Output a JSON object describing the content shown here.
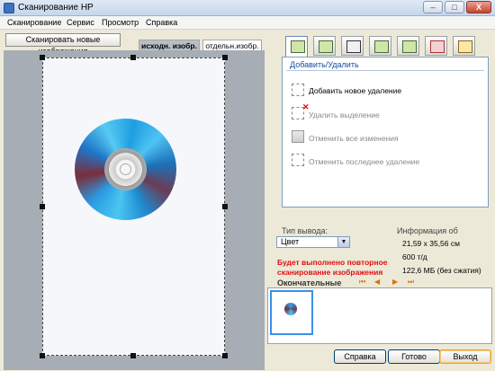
{
  "window": {
    "title": "Сканирование HP",
    "buttons": {
      "minimize": "–",
      "maximize": "□",
      "close": "X"
    }
  },
  "menu": [
    "Сканирование",
    "Сервис",
    "Просмотр",
    "Справка"
  ],
  "scan_new_button": "Сканировать новые изображения",
  "tabs": {
    "original": "исходн. изобр.",
    "separate": "отдельн.изобр."
  },
  "panel": {
    "heading": "Добавить/Удалить",
    "actions": [
      {
        "label": "Добавить новое удаление",
        "enabled": true
      },
      {
        "label": "Удалить выделение",
        "enabled": false
      },
      {
        "label": "Отменить все изменения",
        "enabled": false
      },
      {
        "label": "Отменить последнее удаление",
        "enabled": false
      }
    ]
  },
  "output": {
    "label": "Тип вывода:",
    "selected": "Цвет"
  },
  "info": {
    "label": "Информация об",
    "dimensions": "21,59 x 35,56 см",
    "resolution": "600 т/д",
    "size": "122,6 МБ (без сжатия)"
  },
  "warning": "Будет выполнено повторное сканирование изображения",
  "final_label": "Окончательные",
  "nav": [
    "⏮",
    "◀",
    "▶",
    "⏭"
  ],
  "bottom_buttons": {
    "help": "Справка",
    "done": "Готово",
    "exit": "Выход"
  },
  "colors": {
    "accent": "#1a4aa3",
    "warning": "#e01010",
    "thumb_border": "#3b8fe6"
  },
  "icons": [
    "add-remove-icon",
    "crop-icon",
    "resize-icon",
    "color-adjust-icon",
    "rotate-icon",
    "sharpen-icon",
    "settings-icon"
  ]
}
